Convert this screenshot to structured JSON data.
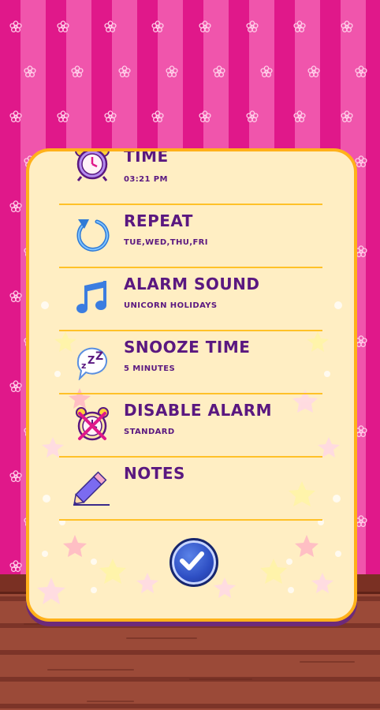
{
  "settings": {
    "rows": [
      {
        "title": "TIME",
        "value": "03:21 PM",
        "icon": "alarm-clock-icon"
      },
      {
        "title": "REPEAT",
        "value": "TUE,WED,THU,FRI",
        "icon": "repeat-arrow-icon"
      },
      {
        "title": "ALARM SOUND",
        "value": "UNICORN HOLIDAYS",
        "icon": "music-note-icon"
      },
      {
        "title": "SNOOZE TIME",
        "value": "5 MINUTES",
        "icon": "snooze-zzz-icon"
      },
      {
        "title": "DISABLE ALARM",
        "value": "STANDARD",
        "icon": "disabled-alarm-icon"
      },
      {
        "title": "NOTES",
        "value": "",
        "icon": "pencil-icon"
      }
    ]
  },
  "confirm": {
    "icon": "checkmark-icon"
  },
  "colors": {
    "wallpaper_dark": "#e0188a",
    "wallpaper_light": "#f055ac",
    "card_bg": "#ffeec3",
    "card_border": "#ffb11a",
    "text": "#5a1880",
    "button": "#2e4fc4"
  }
}
